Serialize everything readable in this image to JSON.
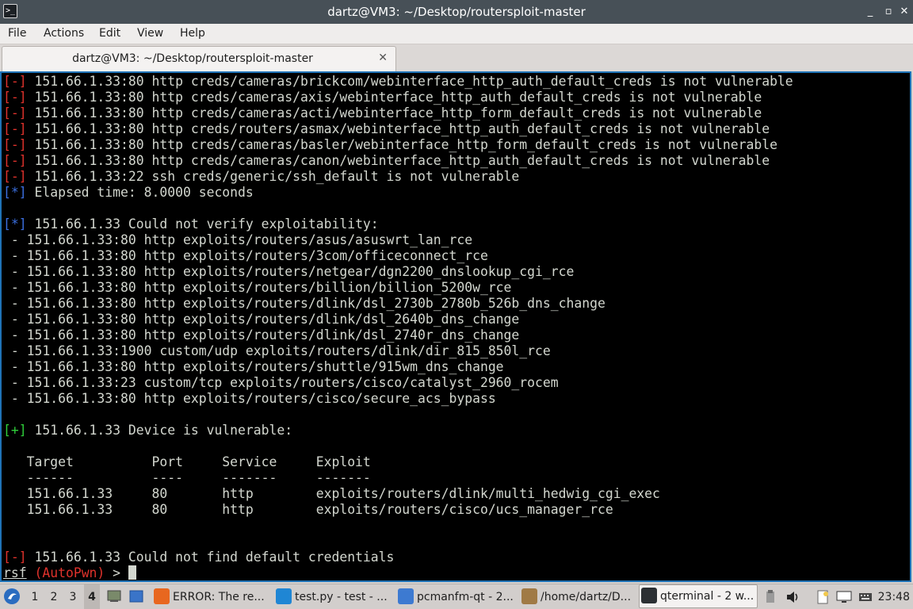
{
  "window": {
    "title": "dartz@VM3: ~/Desktop/routersploit-master",
    "controls": {
      "minimize": "_",
      "maximize": "▫",
      "restore": "◇",
      "close": "✕"
    }
  },
  "menu": [
    "File",
    "Actions",
    "Edit",
    "View",
    "Help"
  ],
  "tab": {
    "label": "dartz@VM3: ~/Desktop/routersploit-master",
    "close": "✕"
  },
  "terminal": {
    "lines": [
      {
        "marker": "[-]",
        "color": "red",
        "text": " 151.66.1.33:80 http creds/cameras/brickcom/webinterface_http_auth_default_creds is not vulnerable"
      },
      {
        "marker": "[-]",
        "color": "red",
        "text": " 151.66.1.33:80 http creds/cameras/axis/webinterface_http_auth_default_creds is not vulnerable"
      },
      {
        "marker": "[-]",
        "color": "red",
        "text": " 151.66.1.33:80 http creds/cameras/acti/webinterface_http_form_default_creds is not vulnerable"
      },
      {
        "marker": "[-]",
        "color": "red",
        "text": " 151.66.1.33:80 http creds/routers/asmax/webinterface_http_auth_default_creds is not vulnerable"
      },
      {
        "marker": "[-]",
        "color": "red",
        "text": " 151.66.1.33:80 http creds/cameras/basler/webinterface_http_form_default_creds is not vulnerable"
      },
      {
        "marker": "[-]",
        "color": "red",
        "text": " 151.66.1.33:80 http creds/cameras/canon/webinterface_http_auth_default_creds is not vulnerable"
      },
      {
        "marker": "[-]",
        "color": "red",
        "text": " 151.66.1.33:22 ssh creds/generic/ssh_default is not vulnerable"
      },
      {
        "marker": "[*]",
        "color": "blue",
        "text": " Elapsed time: 8.0000 seconds"
      },
      {
        "marker": "",
        "color": "",
        "text": ""
      },
      {
        "marker": "[*]",
        "color": "blue",
        "text": " 151.66.1.33 Could not verify exploitability:"
      },
      {
        "marker": "",
        "color": "",
        "text": " - 151.66.1.33:80 http exploits/routers/asus/asuswrt_lan_rce"
      },
      {
        "marker": "",
        "color": "",
        "text": " - 151.66.1.33:80 http exploits/routers/3com/officeconnect_rce"
      },
      {
        "marker": "",
        "color": "",
        "text": " - 151.66.1.33:80 http exploits/routers/netgear/dgn2200_dnslookup_cgi_rce"
      },
      {
        "marker": "",
        "color": "",
        "text": " - 151.66.1.33:80 http exploits/routers/billion/billion_5200w_rce"
      },
      {
        "marker": "",
        "color": "",
        "text": " - 151.66.1.33:80 http exploits/routers/dlink/dsl_2730b_2780b_526b_dns_change"
      },
      {
        "marker": "",
        "color": "",
        "text": " - 151.66.1.33:80 http exploits/routers/dlink/dsl_2640b_dns_change"
      },
      {
        "marker": "",
        "color": "",
        "text": " - 151.66.1.33:80 http exploits/routers/dlink/dsl_2740r_dns_change"
      },
      {
        "marker": "",
        "color": "",
        "text": " - 151.66.1.33:1900 custom/udp exploits/routers/dlink/dir_815_850l_rce"
      },
      {
        "marker": "",
        "color": "",
        "text": " - 151.66.1.33:80 http exploits/routers/shuttle/915wm_dns_change"
      },
      {
        "marker": "",
        "color": "",
        "text": " - 151.66.1.33:23 custom/tcp exploits/routers/cisco/catalyst_2960_rocem"
      },
      {
        "marker": "",
        "color": "",
        "text": " - 151.66.1.33:80 http exploits/routers/cisco/secure_acs_bypass"
      },
      {
        "marker": "",
        "color": "",
        "text": ""
      },
      {
        "marker": "[+]",
        "color": "green",
        "text": " 151.66.1.33 Device is vulnerable:"
      },
      {
        "marker": "",
        "color": "",
        "text": ""
      },
      {
        "marker": "",
        "color": "",
        "text": "   Target          Port     Service     Exploit"
      },
      {
        "marker": "",
        "color": "",
        "text": "   ------          ----     -------     -------"
      },
      {
        "marker": "",
        "color": "",
        "text": "   151.66.1.33     80       http        exploits/routers/dlink/multi_hedwig_cgi_exec"
      },
      {
        "marker": "",
        "color": "",
        "text": "   151.66.1.33     80       http        exploits/routers/cisco/ucs_manager_rce"
      },
      {
        "marker": "",
        "color": "",
        "text": ""
      },
      {
        "marker": "",
        "color": "",
        "text": ""
      },
      {
        "marker": "[-]",
        "color": "red",
        "text": " 151.66.1.33 Could not find default credentials"
      }
    ],
    "prompt": {
      "rsf": "rsf",
      "module": "(AutoPwn)",
      "arrow": " > "
    }
  },
  "taskbar": {
    "desktops": [
      "1",
      "2",
      "3",
      "4"
    ],
    "current_desktop": "4",
    "tasks": [
      {
        "label": "ERROR: The re...",
        "icon": "firefox-icon",
        "color": "#e8671f"
      },
      {
        "label": "test.py - test - ...",
        "icon": "vscode-icon",
        "color": "#1f86d4"
      },
      {
        "label": "pcmanfm-qt - 2...",
        "icon": "folder-icon",
        "color": "#3d7ad1"
      },
      {
        "label": "/home/dartz/D...",
        "icon": "archive-icon",
        "color": "#a07a45"
      },
      {
        "label": "qterminal - 2 w...",
        "icon": "terminal-icon",
        "color": "#2b2f33",
        "active": true
      }
    ],
    "clock": "23:48"
  }
}
